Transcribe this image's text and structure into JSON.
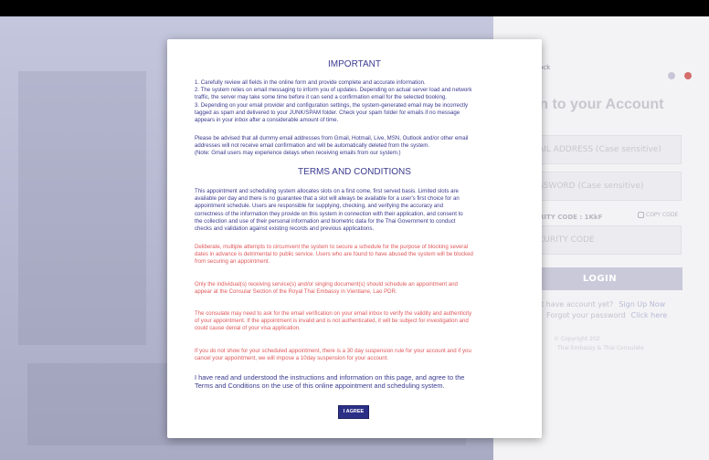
{
  "login_panel": {
    "back_text": "ock",
    "heading": "gin to your Account",
    "email_placeholder": "AIL ADDRESS (Case sensitive)",
    "password_placeholder": "SSWORD (Case sensitive)",
    "security_code_label": "RITY CODE : 1KkF",
    "copy_code_label": "COPY CODE",
    "security_code_placeholder": "CURITY CODE",
    "login_button": "LOGIN",
    "no_account_text": "t have account yet?",
    "signup_link": "Sign Up Now",
    "forgot_text": "Forgot your password",
    "click_here_link": "Click here",
    "copyright_line1": "© Copyright 202",
    "copyright_line2": "Thai Embassy & Thai Consulate",
    "flag_colors": {
      "th": "#c9c4d8",
      "en": "#d56d6d"
    }
  },
  "modal": {
    "important_title": "IMPORTANT",
    "important_lines": [
      "1. Carefully review all fields in the online form and provide complete and accurate information.",
      "2. The system relies on email messaging to inform you of updates. Depending on actual server load and network",
      "traffic, the server may take some time before it can send a confirmation email for the selected booking.",
      "3. Depending on your email provider and configuration settings, the system-generated email may be incorrectly",
      "tagged as spam and delivered to your JUNK/SPAM folder. Check your spam folder for emails if no message",
      "appears in your inbox after a considerable amount of time."
    ],
    "dummy_lines": [
      "Please be advised that all dummy email addresses from Gmail, Hotmail, Live, MSN, Outlook and/or other email",
      "addresses will not receive email confirmation and will be automatically deleted from the system.",
      "(Note: Gmail users may experience delays when receiving emails from our system.)"
    ],
    "terms_title": "TERMS AND CONDITIONS",
    "terms_lines": [
      "This appointment and scheduling system allocates slots on a first come, first served basis. Limited slots are",
      "available per day and there is no guarantee that a slot will always be available for a user's first choice for an",
      "appointment schedule. Users are responsible for supplying, checking, and verifying the accuracy and",
      "correctness of the information they provide on this system in connection with their application, and consent to",
      "the collection and use of their personal information and biometric data for the Thai Government to conduct",
      "checks and validation against existing records and previous applications."
    ],
    "red_para1": [
      "Deliberate, multiple attempts to circumvent the system to secure a schedule for the purpose of blocking several",
      "dates in advance is detrimental to public service. Users who are found to have abused the system will be blocked",
      "from securing an appointment."
    ],
    "red_para2": [
      "Only the individual(s) receiving service(s) and/or singing document(s) should schedule an appointment and",
      "appear at the Consular Section of the Royal Thai Embassy in Vientiane, Lao PDR."
    ],
    "red_para3": [
      "The consulate may need to ask for the email verification on your email inbox to verify the validity and authenticity",
      "of your appointment. If the appointment is invalid and is not authenticated, it will be subject for investigation and",
      "could cause denial of your visa application."
    ],
    "red_para4": [
      "If you do not show for your scheduled appointment, there is a 30 day suspension rule for your account and if you",
      "cancel your appointment, we will impose a 10day suspension for your account."
    ],
    "agreement_lines": [
      "I have read and understood the instructions and information on this page, and agree to the",
      "Terms and Conditions on the use of this online appointment and scheduling system."
    ],
    "agree_button": "I AGREE"
  }
}
